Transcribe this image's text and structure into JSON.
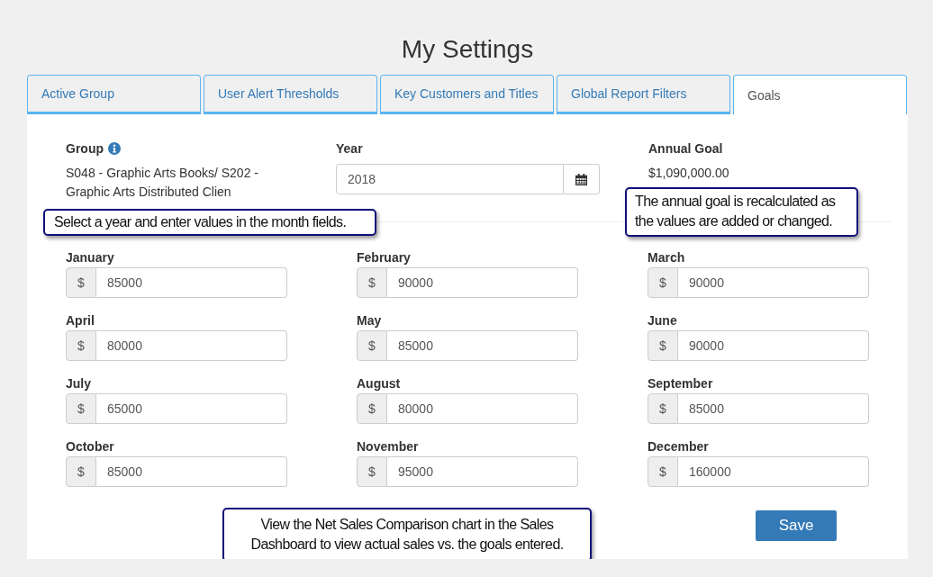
{
  "page": {
    "title": "My Settings"
  },
  "tabs": [
    {
      "label": "Active Group",
      "selected": false
    },
    {
      "label": "User Alert Thresholds",
      "selected": false
    },
    {
      "label": "Key Customers and Titles",
      "selected": false
    },
    {
      "label": "Global Report Filters",
      "selected": false
    },
    {
      "label": "Goals",
      "selected": true
    }
  ],
  "group": {
    "label": "Group",
    "value": "S048 - Graphic Arts Books/ S202 - Graphic Arts Distributed Clien"
  },
  "year": {
    "label": "Year",
    "value": "2018"
  },
  "annual_goal": {
    "label": "Annual Goal",
    "value": "$1,090,000.00"
  },
  "months": [
    {
      "label": "January",
      "prefix": "$",
      "value": "85000"
    },
    {
      "label": "February",
      "prefix": "$",
      "value": "90000"
    },
    {
      "label": "March",
      "prefix": "$",
      "value": "90000"
    },
    {
      "label": "April",
      "prefix": "$",
      "value": "80000"
    },
    {
      "label": "May",
      "prefix": "$",
      "value": "85000"
    },
    {
      "label": "June",
      "prefix": "$",
      "value": "90000"
    },
    {
      "label": "July",
      "prefix": "$",
      "value": "65000"
    },
    {
      "label": "August",
      "prefix": "$",
      "value": "80000"
    },
    {
      "label": "September",
      "prefix": "$",
      "value": "85000"
    },
    {
      "label": "October",
      "prefix": "$",
      "value": "85000"
    },
    {
      "label": "November",
      "prefix": "$",
      "value": "95000"
    },
    {
      "label": "December",
      "prefix": "$",
      "value": "160000"
    }
  ],
  "save_button": {
    "label": "Save"
  },
  "callouts": [
    {
      "text": "Select a year and enter values in the month fields."
    },
    {
      "text": "The annual goal is recalculated as the values are added or changed."
    },
    {
      "text": "View the Net Sales Comparison chart in the Sales Dashboard to view actual sales vs. the goals entered."
    }
  ]
}
